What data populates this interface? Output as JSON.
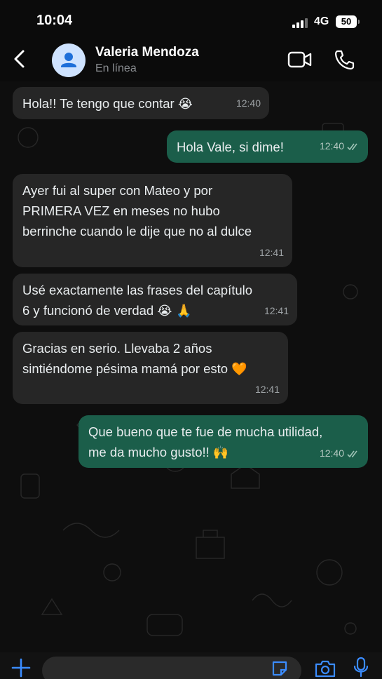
{
  "status_bar": {
    "time": "10:04",
    "network": "4G",
    "battery": "50"
  },
  "header": {
    "contact_name": "Valeria Mendoza",
    "contact_status": "En línea",
    "icons": [
      "back-arrow-icon",
      "avatar-person-icon",
      "video-call-icon",
      "phone-call-icon"
    ]
  },
  "messages": [
    {
      "direction": "in",
      "text": "Hola!! Te tengo que contar",
      "emoji": "😭",
      "time": "12:40"
    },
    {
      "direction": "out",
      "text": "Hola Vale, si dime!",
      "emoji": "",
      "time": "12:40",
      "read": true
    },
    {
      "direction": "in",
      "text": "Ayer fui al super con Mateo y por\nPRIMERA VEZ en meses no hubo\nberrinche cuando le dije que no al dulce",
      "emoji": "",
      "time": "12:41"
    },
    {
      "direction": "in",
      "text": "Usé exactamente las frases del capítulo\n6 y funcionó de verdad",
      "emoji": "😭 🙏",
      "time": "12:41"
    },
    {
      "direction": "in",
      "text": "Gracias en serio. Llevaba 2 años\nsintiéndome pésima mamá por esto",
      "emoji": "🧡",
      "time": "12:41"
    },
    {
      "direction": "out",
      "text": "Que bueno que te fue de mucha utilidad,\nme da mucho gusto!!",
      "emoji": "🙌",
      "time": "12:40",
      "read": true
    }
  ],
  "composer": {
    "icons": [
      "plus-icon",
      "sticker-icon",
      "camera-icon",
      "microphone-icon"
    ]
  },
  "colors": {
    "incoming_bubble": "#262626",
    "outgoing_bubble": "#1b5e4a",
    "background": "#0e0e0e",
    "accent": "#25d366"
  }
}
